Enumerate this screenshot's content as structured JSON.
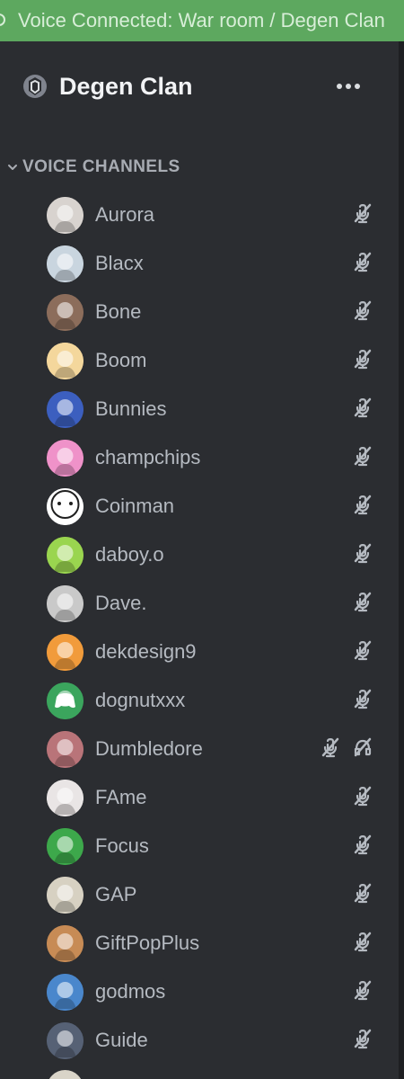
{
  "banner": {
    "text": "Voice Connected: War room / Degen Clan"
  },
  "server": {
    "name": "Degen Clan",
    "icon": "server-shield-icon",
    "menu_icon": "more-horizontal-icon"
  },
  "category": {
    "label": "VOICE CHANNELS",
    "icon": "chevron-down-icon"
  },
  "members": [
    {
      "name": "Aurora",
      "avatar_color": "#d8d3cf"
    },
    {
      "name": "Blacx",
      "avatar_color": "#c9d5df"
    },
    {
      "name": "Bone",
      "avatar_color": "#8c6d5b"
    },
    {
      "name": "Boom",
      "avatar_color": "#f4d79c"
    },
    {
      "name": "Bunnies",
      "avatar_color": "#3c5fbf"
    },
    {
      "name": "champchips",
      "avatar_color": "#ef92c9"
    },
    {
      "name": "Coinman",
      "avatar_color": "#ffffff"
    },
    {
      "name": "daboy.o",
      "avatar_color": "#9ad54f"
    },
    {
      "name": "Dave.",
      "avatar_color": "#c9c9c9"
    },
    {
      "name": "dekdesign9",
      "avatar_color": "#f19b3b"
    },
    {
      "name": "dognutxxx",
      "avatar_color": "#3ba55d"
    },
    {
      "name": "Dumbledore",
      "avatar_color": "#b97479",
      "deafened": true
    },
    {
      "name": "FAme",
      "avatar_color": "#e9e5e5"
    },
    {
      "name": "Focus",
      "avatar_color": "#3da84b"
    },
    {
      "name": "GAP",
      "avatar_color": "#d7d1c2"
    },
    {
      "name": "GiftPopPlus",
      "avatar_color": "#c78b55"
    },
    {
      "name": "godmos",
      "avatar_color": "#4a87cc"
    },
    {
      "name": "Guide",
      "avatar_color": "#566175"
    }
  ],
  "colors": {
    "banner": "#5da85f",
    "background": "#2b2d31",
    "scroll_rail": "#1e1f22",
    "member_text": "#b5bac1",
    "icon": "#b5bac1"
  },
  "icons": {
    "muted": "muted-microphone-icon",
    "deafened": "deafened-headphones-icon"
  }
}
